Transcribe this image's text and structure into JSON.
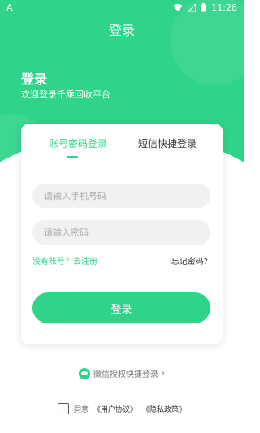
{
  "status_bar": {
    "left_icon": "A",
    "time": "11:28",
    "battery_icon": "battery-icon"
  },
  "nav": {
    "title": "登录"
  },
  "welcome": {
    "title": "登录",
    "subtitle": "欢迎登录千乘回收平台"
  },
  "tabs": [
    {
      "label": "账号密码登录",
      "active": true
    },
    {
      "label": "短信快捷登录",
      "active": false
    }
  ],
  "form": {
    "phone_placeholder": "请输入手机号码",
    "phone_value": "",
    "password_placeholder": "请输入密码",
    "password_value": "",
    "register_link": "没有账号？去注册",
    "forgot_link": "忘记密码?",
    "login_button": "登录"
  },
  "wechat": {
    "label": "微信授权快捷登录",
    "arrow": "›"
  },
  "agreement": {
    "prefix": "同意",
    "user_agreement": "《用户协议》",
    "privacy_policy": "《隐私政策》"
  },
  "colors": {
    "accent": "#2fd38a"
  }
}
